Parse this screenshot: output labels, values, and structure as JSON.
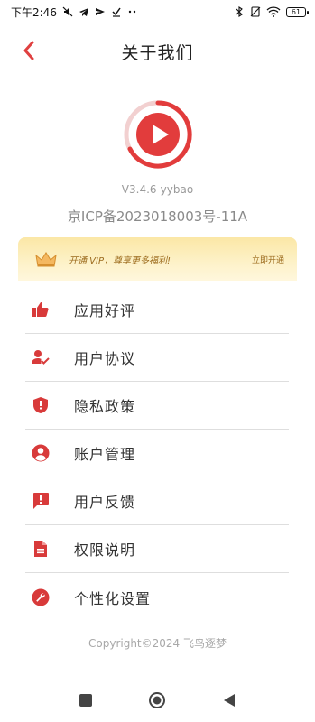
{
  "status_bar": {
    "time": "下午2:46",
    "battery": "61"
  },
  "header": {
    "title": "关于我们"
  },
  "app": {
    "version": "V3.4.6-yybao",
    "icp": "京ICP备2023018003号-11A"
  },
  "vip_banner": {
    "text": "开通 VIP，尊享更多福利!",
    "action": "立即开通"
  },
  "menu": {
    "items": [
      {
        "label": "应用好评",
        "icon": "thumbs-up-icon"
      },
      {
        "label": "用户协议",
        "icon": "user-check-icon"
      },
      {
        "label": "隐私政策",
        "icon": "shield-icon"
      },
      {
        "label": "账户管理",
        "icon": "account-circle-icon"
      },
      {
        "label": "用户反馈",
        "icon": "feedback-icon"
      },
      {
        "label": "权限说明",
        "icon": "document-icon"
      },
      {
        "label": "个性化设置",
        "icon": "wrench-icon"
      }
    ]
  },
  "footer": {
    "copyright": "Copyright©2024 飞鸟逐梦"
  },
  "colors": {
    "accent": "#e04040",
    "vip_text": "#9b6a1c",
    "vip_bg": "#fbe7a6"
  }
}
